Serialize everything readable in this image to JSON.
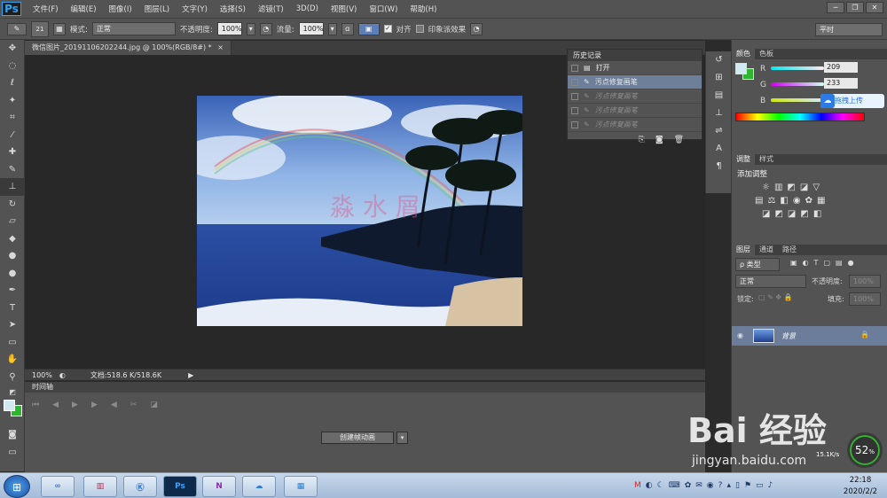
{
  "app": {
    "logo": "Ps"
  },
  "menu": [
    "文件(F)",
    "编辑(E)",
    "图像(I)",
    "图层(L)",
    "文字(Y)",
    "选择(S)",
    "滤镜(T)",
    "3D(D)",
    "视图(V)",
    "窗口(W)",
    "帮助(H)"
  ],
  "window_controls": [
    "─",
    "❐",
    "✕"
  ],
  "options": {
    "brush_size": "21",
    "mode_label": "模式:",
    "mode_value": "正常",
    "opacity_label": "不透明度:",
    "opacity_value": "100%",
    "flow_label": "流量:",
    "flow_value": "100%",
    "align_label": "对齐",
    "align_checked": true,
    "sample_label": "印象派效果",
    "sample_checked": false,
    "workspace": "平时"
  },
  "document": {
    "tab_title": "微信图片_20191106202244.jpg @ 100%(RGB/8#) *",
    "close": "×",
    "watermark": "淼 水 屑"
  },
  "status": {
    "zoom": "100%",
    "doc_info": "文档:518.6 K/518.6K"
  },
  "timeline": {
    "title": "时间轴",
    "create_button": "创建帧动画"
  },
  "history": {
    "tabs": [
      "历史记录"
    ],
    "rows": [
      {
        "label": "打开",
        "state": "normal"
      },
      {
        "label": "污点修复画笔",
        "state": "selected"
      },
      {
        "label": "污点修复画笔",
        "state": "disabled"
      },
      {
        "label": "污点修复画笔",
        "state": "disabled"
      },
      {
        "label": "污点修复画笔",
        "state": "disabled"
      }
    ]
  },
  "color_panel": {
    "tabs": [
      "颜色",
      "色板"
    ],
    "channels": [
      {
        "label": "R",
        "value": "209"
      },
      {
        "label": "G",
        "value": "233"
      },
      {
        "label": "B",
        "value": ""
      }
    ],
    "fg_color": "#d1e9f0",
    "bg_color": "#2fb52f",
    "badge": "拖拽上传"
  },
  "adjustments": {
    "tabs": [
      "调整",
      "样式"
    ],
    "title": "添加调整"
  },
  "layers": {
    "tabs": [
      "图层",
      "通道",
      "路径"
    ],
    "filter": "ρ 类型",
    "blend": "正常",
    "opacity_label": "不透明度:",
    "opacity_value": "100%",
    "lock_label": "锁定:",
    "fill_label": "填充:",
    "fill_value": "100%",
    "layer_name": "背景"
  },
  "taskbar": {
    "time": "22:18",
    "date": "2020/2/2",
    "net_speed": "15.1K/s",
    "percent": "52",
    "percent_unit": "%",
    "baidu_logo": "Bai 经验",
    "baidu_url": "jingyan.baidu.com"
  }
}
